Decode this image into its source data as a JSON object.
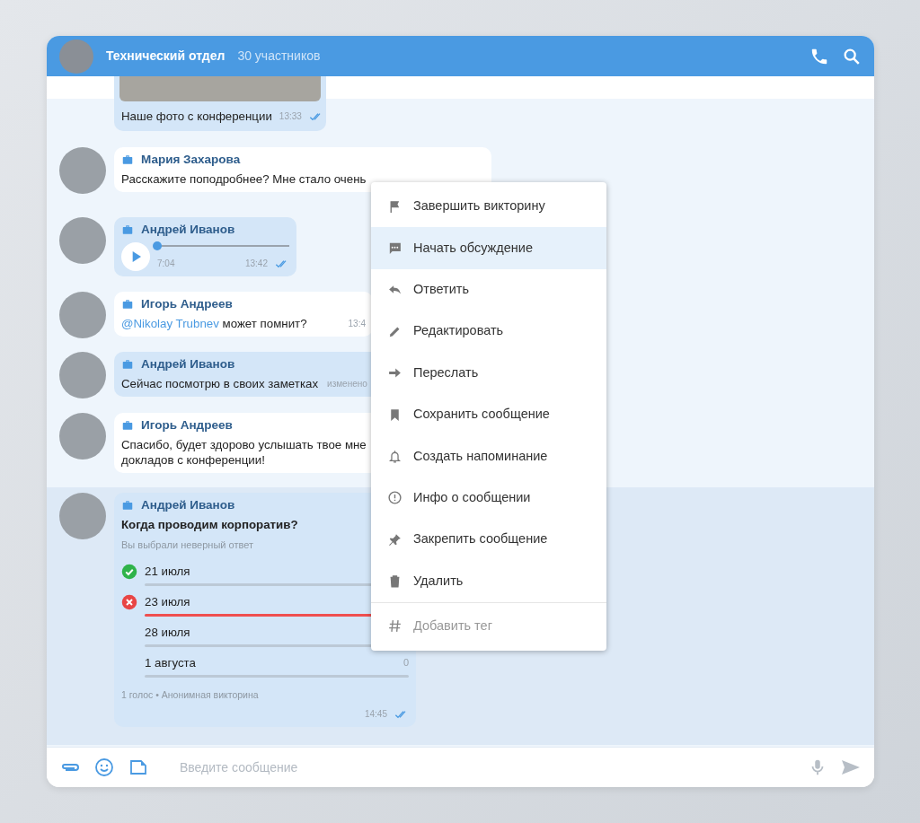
{
  "header": {
    "title": "Технический отдел",
    "subtitle": "30 участников"
  },
  "messages": [
    {
      "kind": "photo",
      "outgoing": true,
      "text": "Наше фото с конференции",
      "time": "13:33",
      "highlighted": false
    },
    {
      "kind": "text",
      "outgoing": false,
      "author": "Мария Захарова",
      "lines": [
        "Расскажите поподробнее? Мне стало очень"
      ],
      "highlighted": false
    },
    {
      "kind": "voice",
      "outgoing": true,
      "author": "Андрей Иванов",
      "duration": "7:04",
      "time": "13:42",
      "level": 0,
      "highlighted": false
    },
    {
      "kind": "text",
      "outgoing": false,
      "author": "Игорь Андреев",
      "mention": "@Nikolay Trubnev",
      "lines": [
        "может помнит?"
      ],
      "time": "13:4",
      "highlighted": false
    },
    {
      "kind": "text",
      "outgoing": true,
      "author": "Андрей Иванов",
      "lines": [
        "Сейчас посмотрю в своих заметках"
      ],
      "time": "изменено",
      "highlighted": false
    },
    {
      "kind": "text",
      "outgoing": false,
      "author": "Игорь Андреев",
      "lines": [
        "Спасибо, будет здорово услышать твое мне",
        "докладов с конференции!"
      ],
      "highlighted": false
    },
    {
      "kind": "poll",
      "outgoing": true,
      "author": "Андрей Иванов",
      "question": "Когда проводим корпоратив?",
      "note": "Вы выбрали неверный ответ",
      "options": [
        {
          "label": "21 июля",
          "correct": true,
          "chosen": false,
          "level": 0
        },
        {
          "label": "23 июля",
          "correct": false,
          "chosen": true,
          "level": 1
        },
        {
          "label": "28 июля",
          "correct": false,
          "chosen": false,
          "level": 0
        },
        {
          "label": "1 августа",
          "correct": false,
          "chosen": false,
          "level": 0,
          "count": "0"
        }
      ],
      "footer": "1 голос • Анонимная викторина",
      "time": "14:45",
      "highlighted": true
    }
  ],
  "context_menu": {
    "items": [
      {
        "label": "Завершить викторину",
        "selected": false,
        "disabled": false
      },
      {
        "label": "Начать обсуждение",
        "selected": true,
        "disabled": false
      },
      {
        "label": "Ответить",
        "selected": false,
        "disabled": false
      },
      {
        "label": "Редактировать",
        "selected": false,
        "disabled": false
      },
      {
        "label": "Переслать",
        "selected": false,
        "disabled": false
      },
      {
        "label": "Сохранить сообщение",
        "selected": false,
        "disabled": false
      },
      {
        "label": "Создать напоминание",
        "selected": false,
        "disabled": false
      },
      {
        "label": "Инфо о сообщении",
        "selected": false,
        "disabled": false
      },
      {
        "label": "Закрепить сообщение",
        "selected": false,
        "disabled": false
      },
      {
        "label": "Удалить",
        "selected": false,
        "disabled": false
      },
      {
        "label": "Добавить тег",
        "selected": false,
        "disabled": true
      }
    ]
  },
  "composer": {
    "placeholder": "Введите сообщение"
  }
}
